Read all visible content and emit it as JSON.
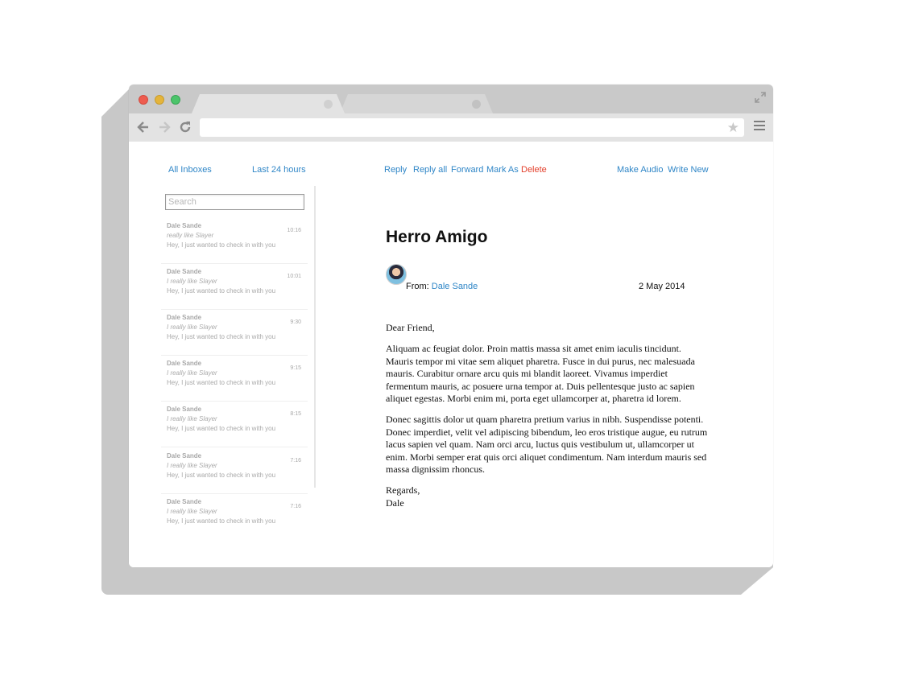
{
  "mail": {
    "top_left": {
      "all_inboxes": "All Inboxes",
      "last_24_hours": "Last 24 hours"
    },
    "actions": {
      "reply": "Reply",
      "reply_all": "Reply all",
      "forward": "Forward",
      "mark_as": "Mark As",
      "delete": "Delete"
    },
    "top_right": {
      "make_audio": "Make Audio",
      "write_new": "Write New"
    },
    "search": {
      "placeholder": "Search",
      "value": ""
    },
    "messages": [
      {
        "from": "Dale Sande",
        "subject": "really like Slayer",
        "preview": "Hey, I just wanted to check in with you",
        "time": "10:16"
      },
      {
        "from": "Dale Sande",
        "subject": "I really like Slayer",
        "preview": "Hey, I just wanted to check in with you",
        "time": "10:01"
      },
      {
        "from": "Dale Sande",
        "subject": "I really like Slayer",
        "preview": "Hey, I just wanted to check in with you",
        "time": "9:30"
      },
      {
        "from": "Dale Sande",
        "subject": "I really like Slayer",
        "preview": "Hey, I just wanted to check in with you",
        "time": "9:15"
      },
      {
        "from": "Dale Sande",
        "subject": "I really like Slayer",
        "preview": "Hey, I just wanted to check in with you",
        "time": "8:15"
      },
      {
        "from": "Dale Sande",
        "subject": "I really like Slayer",
        "preview": "Hey, I just wanted to check in with you",
        "time": "7:16"
      },
      {
        "from": "Dale Sande",
        "subject": "I really like Slayer",
        "preview": "Hey, I just wanted to check in with you",
        "time": "7:16"
      }
    ],
    "open_message": {
      "title": "Herro Amigo",
      "from_label": "From:",
      "from_name": "Dale Sande",
      "date": "2 May 2014",
      "greeting": "Dear Friend,",
      "paragraph1": "Aliquam ac feugiat dolor. Proin mattis massa sit amet enim iaculis tincidunt. Mauris tempor mi vitae sem aliquet pharetra. Fusce in dui purus, nec malesuada mauris. Curabitur ornare arcu quis mi blandit laoreet. Vivamus imperdiet fermentum mauris, ac posuere urna tempor at. Duis pellentesque justo ac sapien aliquet egestas. Morbi enim mi, porta eget ullamcorper at, pharetra id lorem.",
      "paragraph2": "Donec sagittis dolor ut quam pharetra pretium varius in nibh. Suspendisse potenti. Donec imperdiet, velit vel adipiscing bibendum, leo eros tristique augue, eu rutrum lacus sapien vel quam. Nam orci arcu, luctus quis vestibulum ut, ullamcorper ut enim. Morbi semper erat quis orci aliquet condimentum. Nam interdum mauris sed massa dignissim rhoncus.",
      "closing": "Regards,",
      "signature": "Dale"
    }
  },
  "browser": {
    "url": "",
    "icons": [
      "back-icon",
      "forward-icon",
      "reload-icon",
      "star-icon",
      "menu-icon",
      "expand-icon"
    ]
  },
  "colors": {
    "link": "#2f86c7",
    "delete": "#e3402c",
    "chrome": "#e3e3e3",
    "titlebar": "#c9c9c9"
  }
}
